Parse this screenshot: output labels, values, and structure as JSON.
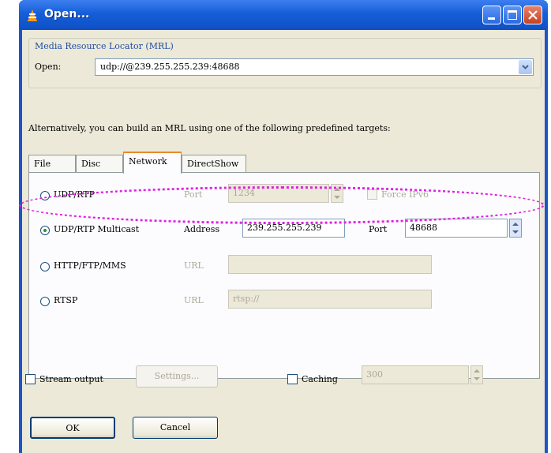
{
  "window": {
    "title": "Open..."
  },
  "mrl_group": {
    "title": "Media Resource Locator (MRL)",
    "open_label": "Open:",
    "open_value": "udp://@239.255.255.239:48688"
  },
  "hint": "Alternatively, you can build an MRL using one of the following predefined targets:",
  "tabs": [
    {
      "label": "File"
    },
    {
      "label": "Disc"
    },
    {
      "label": "Network"
    },
    {
      "label": "DirectShow"
    }
  ],
  "network": {
    "udp": {
      "label": "UDP/RTP",
      "port_label": "Port",
      "port_value": "1234",
      "force_ipv6_label": "Force IPv6"
    },
    "multicast": {
      "label": "UDP/RTP Multicast",
      "address_label": "Address",
      "address_value": "239.255.255.239",
      "port_label": "Port",
      "port_value": "48688"
    },
    "http": {
      "label": "HTTP/FTP/MMS",
      "url_label": "URL",
      "url_value": ""
    },
    "rtsp": {
      "label": "RTSP",
      "url_label": "URL",
      "url_value": "rtsp://"
    }
  },
  "stream_output": {
    "label": "Stream output",
    "settings_label": "Settings..."
  },
  "caching": {
    "label": "Caching",
    "value": "300"
  },
  "buttons": {
    "ok": "OK",
    "cancel": "Cancel"
  },
  "colors": {
    "titlebar": "#155ed8",
    "client_bg": "#ece9d8",
    "highlight": "#e020e0",
    "active_tab_accent": "#e68b2c"
  }
}
